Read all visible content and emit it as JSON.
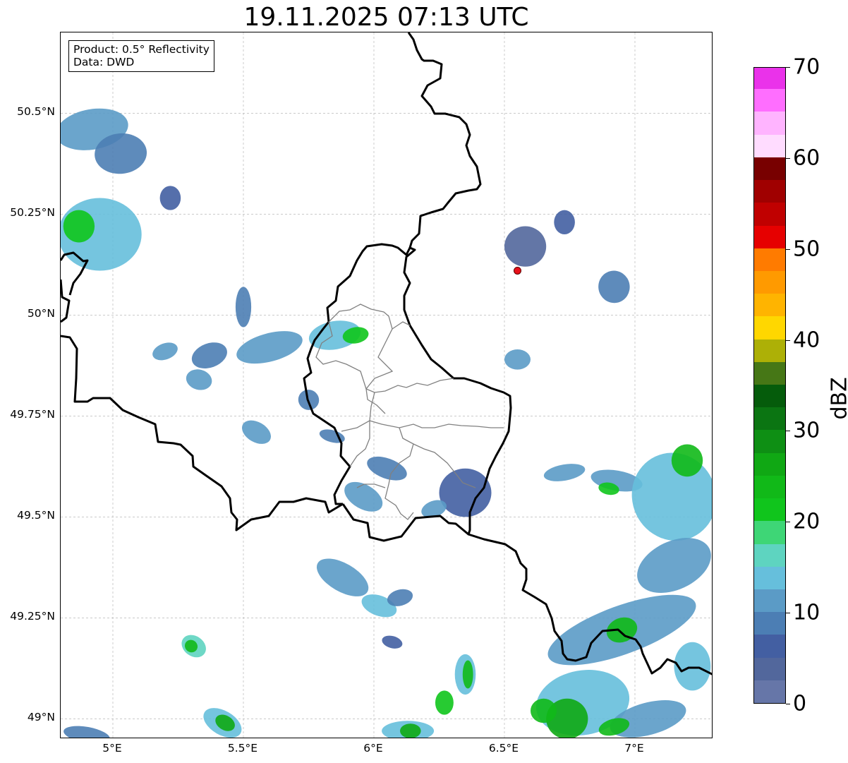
{
  "title": "19.11.2025 07:13 UTC",
  "info": {
    "product": "Product: 0.5° Reflectivity",
    "source": "Data: DWD"
  },
  "map_extent": {
    "lon_min": 4.8,
    "lon_max": 7.3,
    "lat_min": 48.95,
    "lat_max": 50.7
  },
  "lat_ticks": [
    {
      "value": 50.5,
      "label": "50.5°N"
    },
    {
      "value": 50.25,
      "label": "50.25°N"
    },
    {
      "value": 50.0,
      "label": "50°N"
    },
    {
      "value": 49.75,
      "label": "49.75°N"
    },
    {
      "value": 49.5,
      "label": "49.5°N"
    },
    {
      "value": 49.25,
      "label": "49.25°N"
    },
    {
      "value": 49.0,
      "label": "49°N"
    }
  ],
  "lon_ticks": [
    {
      "value": 5.0,
      "label": "5°E"
    },
    {
      "value": 5.5,
      "label": "5.5°E"
    },
    {
      "value": 6.0,
      "label": "6°E"
    },
    {
      "value": 6.5,
      "label": "6.5°E"
    },
    {
      "value": 7.0,
      "label": "7°E"
    }
  ],
  "radar_site": {
    "lon": 6.55,
    "lat": 50.11,
    "color": "#e8111a"
  },
  "colorbar": {
    "unit": "dBZ",
    "min": 0,
    "max": 70,
    "tick_labels": [
      "0",
      "10",
      "20",
      "30",
      "40",
      "50",
      "60",
      "70"
    ],
    "colors": [
      "#6676a8",
      "#52679c",
      "#435fa2",
      "#4c7eb4",
      "#5b9bc6",
      "#66bfdc",
      "#5ed4c0",
      "#3ed676",
      "#10c51c",
      "#11b918",
      "#10a814",
      "#0e8f14",
      "#0b7512",
      "#055c0b",
      "#467716",
      "#adb006",
      "#ffd700",
      "#ffb400",
      "#ff9a00",
      "#ff7b00",
      "#e60000",
      "#c00000",
      "#a00000",
      "#780000",
      "#ffdcff",
      "#ffb4ff",
      "#ff6eff",
      "#ea32ea"
    ]
  },
  "precip_cells": [
    {
      "lon": 4.92,
      "lat": 50.46,
      "rx": 0.14,
      "ry": 0.05,
      "angle": -10,
      "dbz": 10
    },
    {
      "lon": 5.03,
      "lat": 50.4,
      "rx": 0.1,
      "ry": 0.05,
      "angle": -5,
      "dbz": 8
    },
    {
      "lon": 4.95,
      "lat": 50.2,
      "rx": 0.16,
      "ry": 0.09,
      "angle": 0,
      "dbz": 14
    },
    {
      "lon": 4.87,
      "lat": 50.22,
      "rx": 0.06,
      "ry": 0.04,
      "angle": 0,
      "dbz": 22
    },
    {
      "lon": 5.22,
      "lat": 50.29,
      "rx": 0.04,
      "ry": 0.03,
      "angle": 0,
      "dbz": 6
    },
    {
      "lon": 5.37,
      "lat": 49.9,
      "rx": 0.07,
      "ry": 0.03,
      "angle": -20,
      "dbz": 9
    },
    {
      "lon": 5.33,
      "lat": 49.84,
      "rx": 0.05,
      "ry": 0.025,
      "angle": 15,
      "dbz": 12
    },
    {
      "lon": 5.6,
      "lat": 49.92,
      "rx": 0.13,
      "ry": 0.035,
      "angle": -15,
      "dbz": 10
    },
    {
      "lon": 5.85,
      "lat": 49.95,
      "rx": 0.1,
      "ry": 0.035,
      "angle": -10,
      "dbz": 14
    },
    {
      "lon": 5.93,
      "lat": 49.95,
      "rx": 0.05,
      "ry": 0.02,
      "angle": -10,
      "dbz": 22
    },
    {
      "lon": 5.5,
      "lat": 50.02,
      "rx": 0.03,
      "ry": 0.05,
      "angle": 0,
      "dbz": 9
    },
    {
      "lon": 5.2,
      "lat": 49.91,
      "rx": 0.05,
      "ry": 0.02,
      "angle": -20,
      "dbz": 11
    },
    {
      "lon": 5.75,
      "lat": 49.79,
      "rx": 0.04,
      "ry": 0.025,
      "angle": 25,
      "dbz": 9
    },
    {
      "lon": 5.55,
      "lat": 49.71,
      "rx": 0.06,
      "ry": 0.025,
      "angle": 30,
      "dbz": 12
    },
    {
      "lon": 5.84,
      "lat": 49.7,
      "rx": 0.05,
      "ry": 0.015,
      "angle": 15,
      "dbz": 8
    },
    {
      "lon": 6.05,
      "lat": 49.62,
      "rx": 0.08,
      "ry": 0.025,
      "angle": 20,
      "dbz": 9
    },
    {
      "lon": 5.96,
      "lat": 49.55,
      "rx": 0.08,
      "ry": 0.03,
      "angle": 30,
      "dbz": 10
    },
    {
      "lon": 6.35,
      "lat": 49.56,
      "rx": 0.1,
      "ry": 0.06,
      "angle": 0,
      "dbz": 7
    },
    {
      "lon": 6.23,
      "lat": 49.52,
      "rx": 0.05,
      "ry": 0.02,
      "angle": -20,
      "dbz": 11
    },
    {
      "lon": 5.88,
      "lat": 49.35,
      "rx": 0.11,
      "ry": 0.035,
      "angle": 30,
      "dbz": 12
    },
    {
      "lon": 6.02,
      "lat": 49.28,
      "rx": 0.07,
      "ry": 0.025,
      "angle": 20,
      "dbz": 13
    },
    {
      "lon": 6.1,
      "lat": 49.3,
      "rx": 0.05,
      "ry": 0.02,
      "angle": -15,
      "dbz": 9
    },
    {
      "lon": 6.07,
      "lat": 49.19,
      "rx": 0.04,
      "ry": 0.015,
      "angle": 15,
      "dbz": 7
    },
    {
      "lon": 6.55,
      "lat": 49.89,
      "rx": 0.05,
      "ry": 0.025,
      "angle": 0,
      "dbz": 10
    },
    {
      "lon": 6.92,
      "lat": 50.07,
      "rx": 0.06,
      "ry": 0.04,
      "angle": -10,
      "dbz": 8
    },
    {
      "lon": 6.58,
      "lat": 50.17,
      "rx": 0.08,
      "ry": 0.05,
      "angle": 0,
      "dbz": 4
    },
    {
      "lon": 6.73,
      "lat": 50.23,
      "rx": 0.04,
      "ry": 0.03,
      "angle": 0,
      "dbz": 5
    },
    {
      "lon": 6.73,
      "lat": 49.61,
      "rx": 0.08,
      "ry": 0.02,
      "angle": -10,
      "dbz": 10
    },
    {
      "lon": 6.93,
      "lat": 49.59,
      "rx": 0.1,
      "ry": 0.025,
      "angle": 10,
      "dbz": 12
    },
    {
      "lon": 6.9,
      "lat": 49.57,
      "rx": 0.04,
      "ry": 0.015,
      "angle": 10,
      "dbz": 22
    },
    {
      "lon": 7.15,
      "lat": 49.55,
      "rx": 0.16,
      "ry": 0.11,
      "angle": -25,
      "dbz": 14
    },
    {
      "lon": 7.2,
      "lat": 49.64,
      "rx": 0.06,
      "ry": 0.04,
      "angle": 0,
      "dbz": 24
    },
    {
      "lon": 7.15,
      "lat": 49.38,
      "rx": 0.15,
      "ry": 0.06,
      "angle": -25,
      "dbz": 12
    },
    {
      "lon": 6.95,
      "lat": 49.22,
      "rx": 0.3,
      "ry": 0.06,
      "angle": -20,
      "dbz": 12
    },
    {
      "lon": 6.95,
      "lat": 49.22,
      "rx": 0.06,
      "ry": 0.03,
      "angle": -20,
      "dbz": 23
    },
    {
      "lon": 7.22,
      "lat": 49.13,
      "rx": 0.07,
      "ry": 0.06,
      "angle": 0,
      "dbz": 13
    },
    {
      "lon": 6.8,
      "lat": 49.04,
      "rx": 0.18,
      "ry": 0.08,
      "angle": -10,
      "dbz": 13
    },
    {
      "lon": 6.74,
      "lat": 49.0,
      "rx": 0.08,
      "ry": 0.05,
      "angle": 0,
      "dbz": 26
    },
    {
      "lon": 6.65,
      "lat": 49.02,
      "rx": 0.05,
      "ry": 0.03,
      "angle": 0,
      "dbz": 23
    },
    {
      "lon": 7.05,
      "lat": 49.0,
      "rx": 0.15,
      "ry": 0.04,
      "angle": -15,
      "dbz": 12
    },
    {
      "lon": 6.92,
      "lat": 48.98,
      "rx": 0.06,
      "ry": 0.02,
      "angle": -15,
      "dbz": 24
    },
    {
      "lon": 6.35,
      "lat": 49.11,
      "rx": 0.04,
      "ry": 0.05,
      "angle": 0,
      "dbz": 14
    },
    {
      "lon": 6.36,
      "lat": 49.11,
      "rx": 0.02,
      "ry": 0.035,
      "angle": 0,
      "dbz": 23
    },
    {
      "lon": 6.27,
      "lat": 49.04,
      "rx": 0.035,
      "ry": 0.03,
      "angle": 0,
      "dbz": 22
    },
    {
      "lon": 6.13,
      "lat": 48.97,
      "rx": 0.1,
      "ry": 0.025,
      "angle": 0,
      "dbz": 14
    },
    {
      "lon": 6.14,
      "lat": 48.97,
      "rx": 0.04,
      "ry": 0.018,
      "angle": 0,
      "dbz": 25
    },
    {
      "lon": 5.31,
      "lat": 49.18,
      "rx": 0.05,
      "ry": 0.025,
      "angle": 35,
      "dbz": 16
    },
    {
      "lon": 5.3,
      "lat": 49.18,
      "rx": 0.025,
      "ry": 0.015,
      "angle": 35,
      "dbz": 23
    },
    {
      "lon": 5.42,
      "lat": 48.99,
      "rx": 0.08,
      "ry": 0.03,
      "angle": 30,
      "dbz": 14
    },
    {
      "lon": 5.43,
      "lat": 48.99,
      "rx": 0.04,
      "ry": 0.018,
      "angle": 30,
      "dbz": 25
    },
    {
      "lon": 4.9,
      "lat": 48.96,
      "rx": 0.09,
      "ry": 0.02,
      "angle": 10,
      "dbz": 9
    }
  ]
}
